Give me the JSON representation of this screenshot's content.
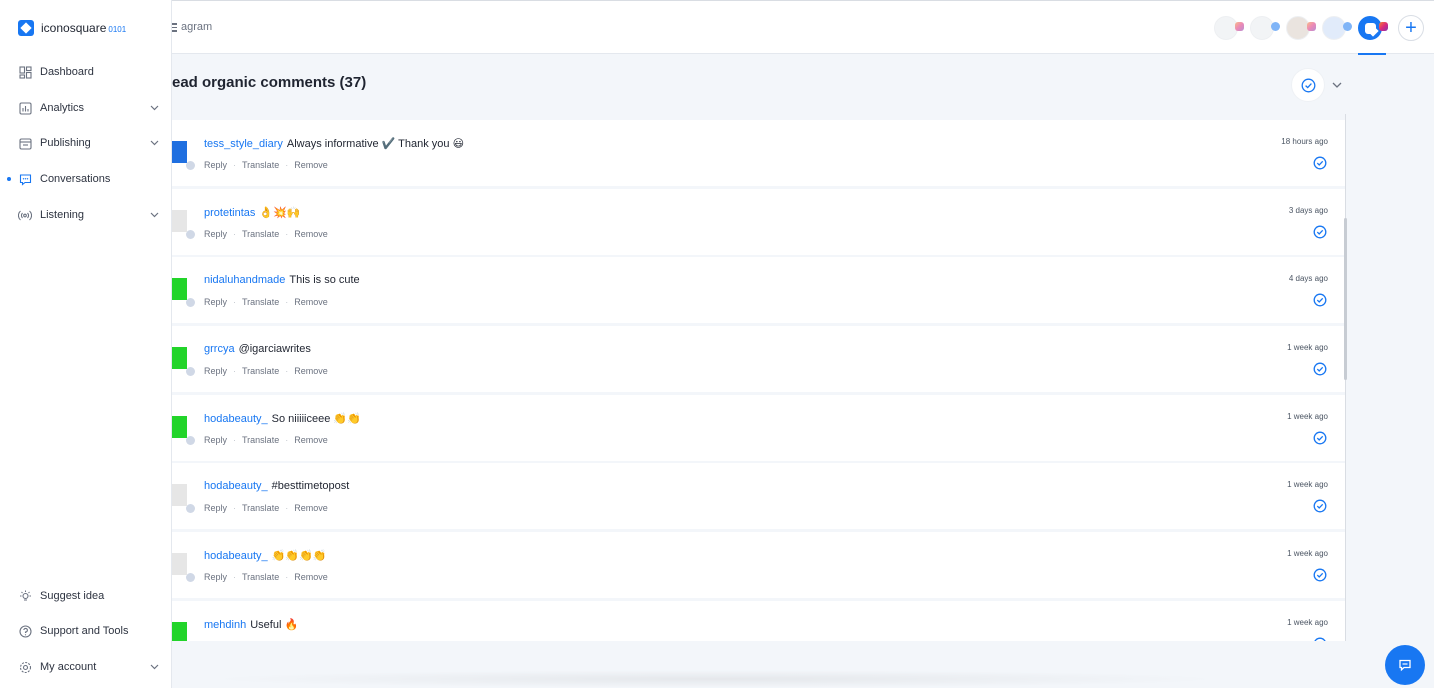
{
  "app": {
    "name": "iconosquare",
    "version": "0101"
  },
  "breadcrumb": "agram",
  "sidebar": {
    "items": [
      {
        "label": "Dashboard",
        "icon": "grid-icon",
        "has_chevron": false,
        "active": false
      },
      {
        "label": "Analytics",
        "icon": "bar-chart-icon",
        "has_chevron": true,
        "active": false
      },
      {
        "label": "Publishing",
        "icon": "calendar-icon",
        "has_chevron": true,
        "active": false
      },
      {
        "label": "Conversations",
        "icon": "chat-icon",
        "has_chevron": false,
        "active": true
      },
      {
        "label": "Listening",
        "icon": "broadcast-icon",
        "has_chevron": true,
        "active": false
      }
    ],
    "footer": [
      {
        "label": "Suggest idea",
        "icon": "lightbulb-icon",
        "has_chevron": false
      },
      {
        "label": "Support and Tools",
        "icon": "help-icon",
        "has_chevron": false
      },
      {
        "label": "My account",
        "icon": "gear-icon",
        "has_chevron": true
      }
    ]
  },
  "section": {
    "title": "ead organic comments (37)"
  },
  "comments": [
    {
      "user": "tess_style_diary",
      "text": "Always informative ✔️ Thank you 😃",
      "time": "18 hours ago",
      "avatar_color": "#1f6fe0"
    },
    {
      "user": "protetintas",
      "text": "👌💥🙌",
      "time": "3 days ago",
      "avatar_color": "#e6e6e6"
    },
    {
      "user": "nidaluhandmade",
      "text": "This is so cute",
      "time": "4 days ago",
      "avatar_color": "#22d42a"
    },
    {
      "user": "grrcya",
      "text": "@igarciawrites",
      "time": "1 week ago",
      "avatar_color": "#22d42a"
    },
    {
      "user": "hodabeauty_",
      "text": "So niiiiiceee 👏👏",
      "time": "1 week ago",
      "avatar_color": "#22d42a"
    },
    {
      "user": "hodabeauty_",
      "text": "#besttimetopost",
      "time": "1 week ago",
      "avatar_color": "#e6e6e6"
    },
    {
      "user": "hodabeauty_",
      "text": "👏👏👏👏",
      "time": "1 week ago",
      "avatar_color": "#e6e6e6"
    },
    {
      "user": "mehdinh",
      "text": "Useful 🔥",
      "time": "1 week ago",
      "avatar_color": "#22d42a"
    }
  ],
  "comment_actions": [
    "Reply",
    "Translate",
    "Remove"
  ],
  "colors": {
    "accent": "#1877f2"
  }
}
